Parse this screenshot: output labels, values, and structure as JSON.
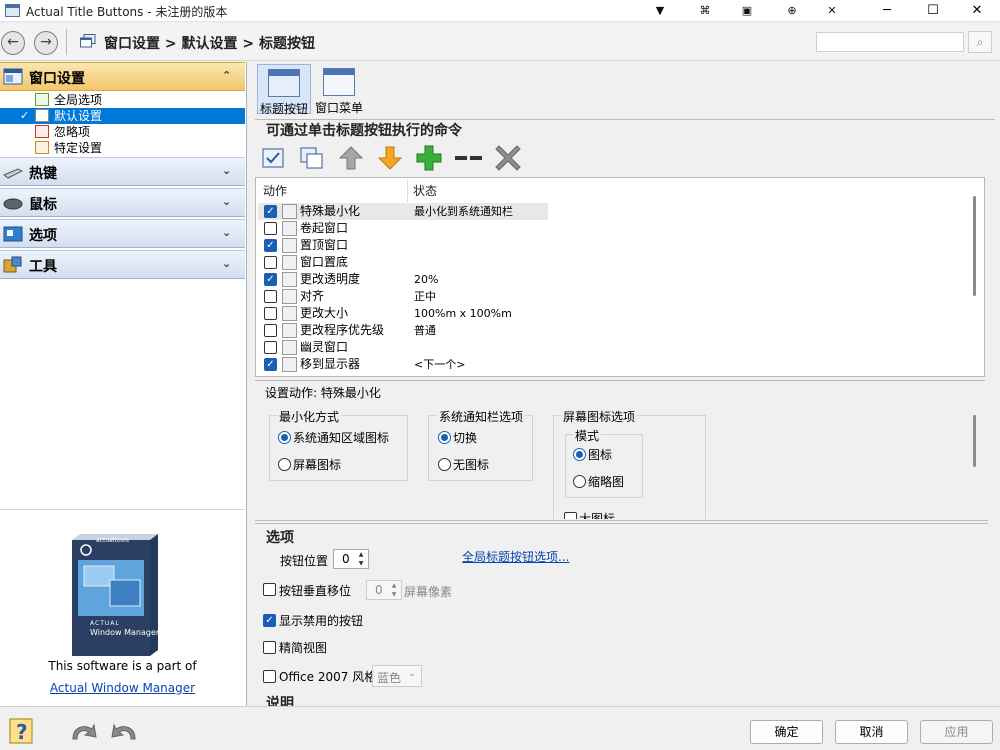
{
  "window": {
    "title": "Actual Title Buttons - 未注册的版本",
    "title_buttons": [
      "▼",
      "⌘",
      "▣",
      "⊕",
      "✕"
    ],
    "minimize": "─",
    "maximize": "☐",
    "close": "✕"
  },
  "nav": {
    "back": "←",
    "forward": "→",
    "breadcrumb": "窗口设置 > 默认设置 > 标题按钮",
    "search_placeholder": "",
    "search_icon": "⌕"
  },
  "sidebar": {
    "sections": [
      {
        "label": "窗口设置",
        "icon": "window-settings-icon",
        "chevron": "⌃",
        "active": true
      },
      {
        "label": "热键",
        "icon": "keyboard-icon",
        "chevron": "⌄"
      },
      {
        "label": "鼠标",
        "icon": "mouse-icon",
        "chevron": "⌄"
      },
      {
        "label": "选项",
        "icon": "options-icon",
        "chevron": "⌄"
      },
      {
        "label": "工具",
        "icon": "tools-icon",
        "chevron": "⌄"
      }
    ],
    "tree": [
      {
        "label": "全局选项",
        "selected": false
      },
      {
        "label": "默认设置",
        "selected": true
      },
      {
        "label": "忽略项",
        "selected": false
      },
      {
        "label": "特定设置",
        "selected": false
      }
    ],
    "product_brand": "actualtools",
    "product_name_1": "ACTUAL",
    "product_name_2": "Window Manager",
    "part_of": "This software is a part of",
    "product_link": "Actual Window Manager"
  },
  "tabs": [
    {
      "label": "标题按钮",
      "selected": true
    },
    {
      "label": "窗口菜单",
      "selected": false
    }
  ],
  "commands": {
    "title": "可通过单击标题按钮执行的命令",
    "toolbar": [
      "check-all-icon",
      "copy-icon",
      "move-up-icon",
      "move-down-icon",
      "add-icon",
      "separator-icon",
      "delete-icon"
    ],
    "columns": {
      "action": "动作",
      "state": "状态"
    },
    "rows": [
      {
        "action": "特殊最小化",
        "state": "最小化到系统通知栏",
        "checked": true,
        "selected": true
      },
      {
        "action": "卷起窗口",
        "state": "",
        "checked": false
      },
      {
        "action": "置顶窗口",
        "state": "",
        "checked": true
      },
      {
        "action": "窗口置底",
        "state": "",
        "checked": false
      },
      {
        "action": "更改透明度",
        "state": "20%",
        "checked": true
      },
      {
        "action": "对齐",
        "state": "正中",
        "checked": false
      },
      {
        "action": "更改大小",
        "state": "100%m x 100%m",
        "checked": false
      },
      {
        "action": "更改程序优先级",
        "state": "普通",
        "checked": false
      },
      {
        "action": "幽灵窗口",
        "state": "",
        "checked": false
      },
      {
        "action": "移到显示器",
        "state": "<下一个>",
        "checked": true
      }
    ]
  },
  "action_settings": {
    "title": "设置动作: 特殊最小化",
    "min_method": {
      "title": "最小化方式",
      "options": [
        "系统通知区域图标",
        "屏幕图标"
      ],
      "selected": 0
    },
    "tray": {
      "title": "系统通知栏选项",
      "options": [
        "切换",
        "无图标"
      ],
      "selected": 0
    },
    "screen_icon": {
      "title": "屏幕图标选项",
      "mode_title": "模式",
      "options": [
        "图标",
        "缩略图"
      ],
      "selected": 0,
      "partial": "大图标"
    }
  },
  "options": {
    "title": "选项",
    "button_position_label": "按钮位置",
    "button_position_value": "0",
    "global_link": "全局标题按钮选项...",
    "vertical_offset_label": "按钮垂直移位",
    "vertical_offset_value": "0",
    "vertical_offset_unit": "屏幕像素",
    "show_disabled_label": "显示禁用的按钮",
    "show_disabled": true,
    "compact_label": "精简视图",
    "compact": false,
    "office_style_label": "Office 2007 风格",
    "office_style": false,
    "office_color": "蓝色",
    "description_title": "说明"
  },
  "footer": {
    "ok": "确定",
    "cancel": "取消",
    "apply": "应用"
  }
}
